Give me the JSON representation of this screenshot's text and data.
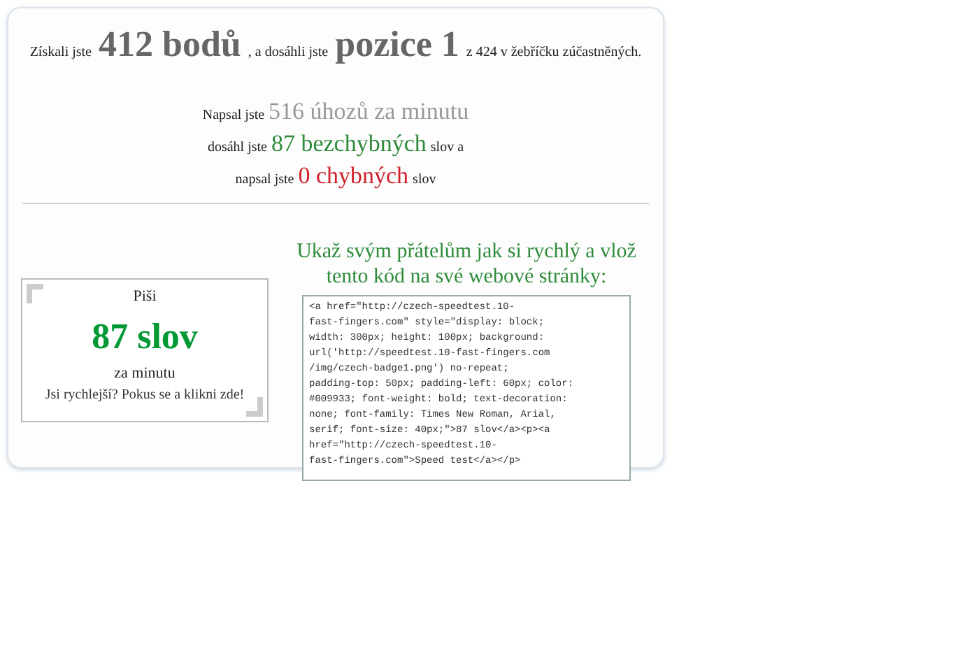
{
  "score_line": [
    {
      "kind": "plain",
      "text": "Získali jste"
    },
    {
      "kind": "big",
      "text": "412 bodů"
    },
    {
      "kind": "plain",
      "text": ", a dosáhli jste"
    },
    {
      "kind": "big",
      "text": "pozice 1"
    },
    {
      "kind": "plain",
      "text": "z 424 v žebříčku zúčastněných."
    }
  ],
  "stats": [
    [
      {
        "kind": "plain",
        "text": "Napsal jste"
      },
      {
        "kind": "grey",
        "text": "516 úhozů za minutu"
      }
    ],
    [
      {
        "kind": "plain",
        "text": "dosáhl jste"
      },
      {
        "kind": "green",
        "text": "87 bezchybných"
      },
      {
        "kind": "plain",
        "text": "slov a"
      }
    ],
    [
      {
        "kind": "plain",
        "text": "napsal jste"
      },
      {
        "kind": "red",
        "text": "0 chybných"
      },
      {
        "kind": "plain",
        "text": "slov"
      }
    ]
  ],
  "badge": {
    "top": "Piši",
    "words": "87 slov",
    "unit": "za minutu",
    "link": "Jsi rychlejší? Pokus se a klikni zde!"
  },
  "share": {
    "heading": "Ukaž svým přátelům jak si rychlý a vlož tento kód na své webové stránky:",
    "code_lines": [
      "<a href=\"http://czech-speedtest.10-",
      "fast-fingers.com\" style=\"display: block;",
      "width: 300px; height: 100px; background:",
      "url('http://speedtest.10-fast-fingers.com",
      "/img/czech-badge1.png') no-repeat;",
      "padding-top: 50px; padding-left: 60px; color:",
      "#009933; font-weight: bold; text-decoration:",
      "none; font-family: Times New Roman, Arial,",
      "serif; font-size: 40px;\">87 slov</a><p><a",
      "href=\"http://czech-speedtest.10-",
      "fast-fingers.com\">Speed test</a></p>"
    ]
  }
}
